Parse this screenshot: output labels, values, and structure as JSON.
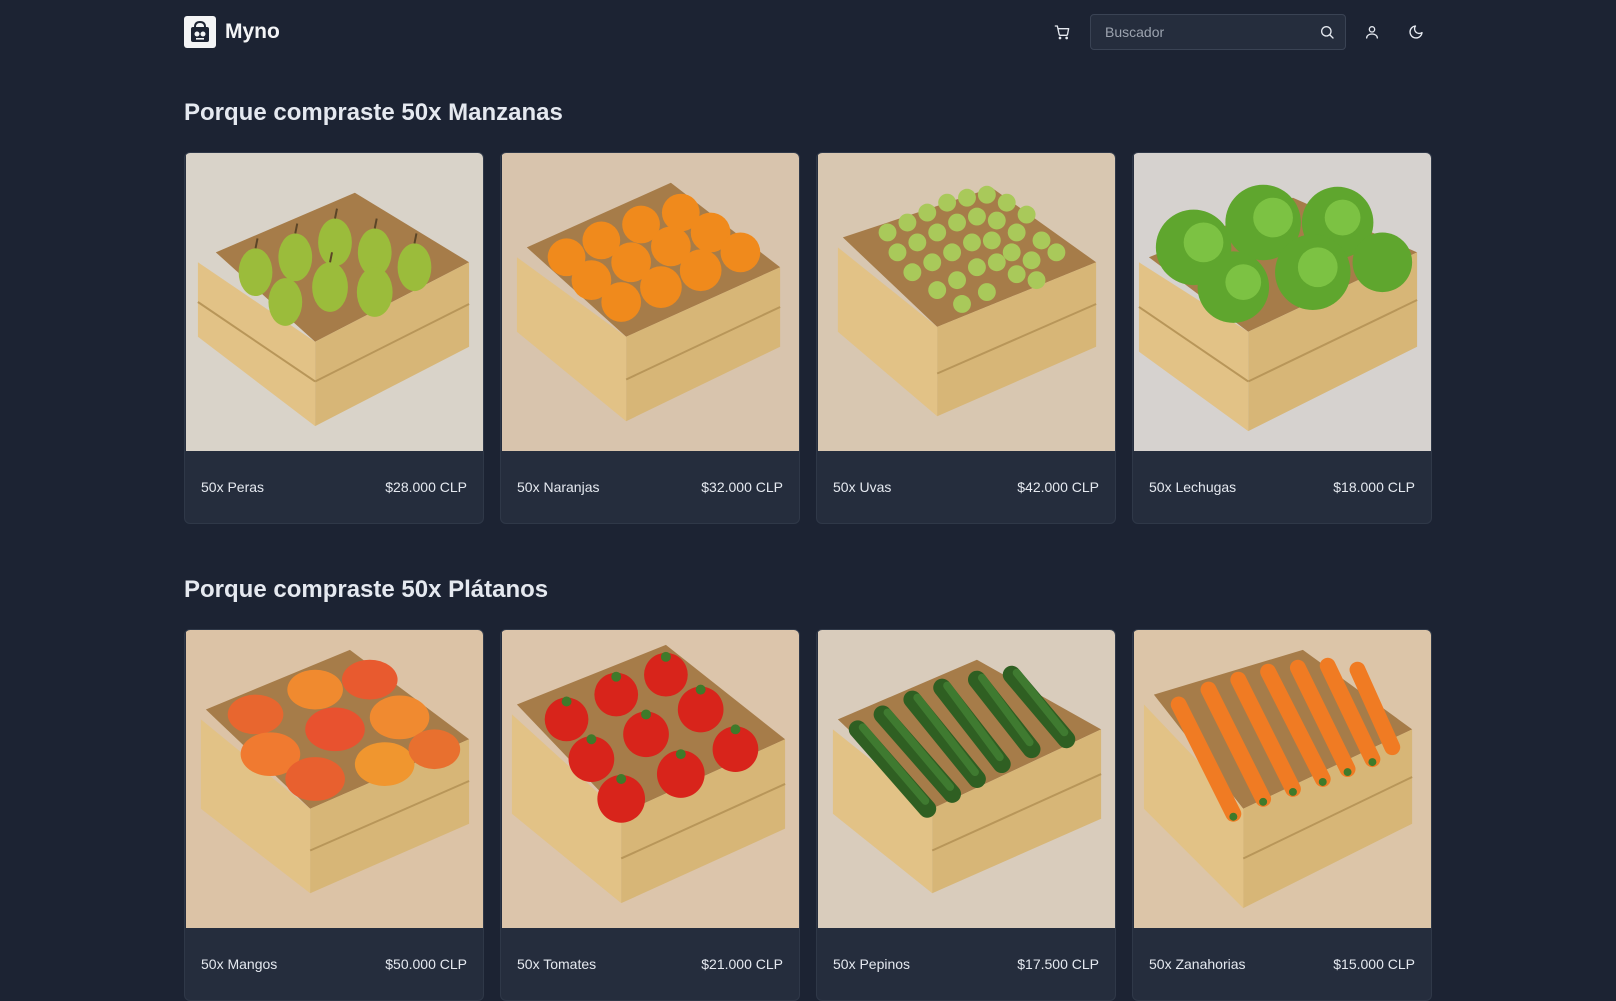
{
  "header": {
    "brand": "Myno",
    "search_placeholder": "Buscador",
    "icons": [
      "logo-icon",
      "cart-icon",
      "search-icon",
      "user-icon",
      "moon-icon"
    ]
  },
  "sections": [
    {
      "title": "Porque compraste 50x Manzanas",
      "products": [
        {
          "name": "50x Peras",
          "price": "$28.000 CLP",
          "image": "pears-crate"
        },
        {
          "name": "50x Naranjas",
          "price": "$32.000 CLP",
          "image": "oranges-crate"
        },
        {
          "name": "50x Uvas",
          "price": "$42.000 CLP",
          "image": "grapes-crate"
        },
        {
          "name": "50x Lechugas",
          "price": "$18.000 CLP",
          "image": "lettuce-crate"
        }
      ]
    },
    {
      "title": "Porque compraste 50x Plátanos",
      "products": [
        {
          "name": "50x Mangos",
          "price": "$50.000 CLP",
          "image": "mangos-crate"
        },
        {
          "name": "50x Tomates",
          "price": "$21.000 CLP",
          "image": "tomatoes-crate"
        },
        {
          "name": "50x Pepinos",
          "price": "$17.500 CLP",
          "image": "cucumbers-crate"
        },
        {
          "name": "50x Zanahorias",
          "price": "$15.000 CLP",
          "image": "carrots-crate"
        }
      ]
    }
  ],
  "colors": {
    "background": "#1c2333",
    "card": "#252d3d",
    "text": "#e5e9f0"
  }
}
